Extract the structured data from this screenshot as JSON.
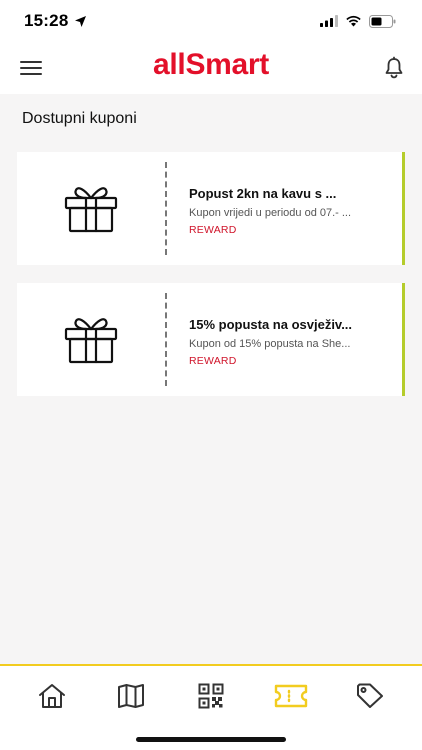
{
  "status_bar": {
    "time": "15:28"
  },
  "header": {
    "logo_text": "allSmart",
    "brand_color": "#e3102a"
  },
  "section": {
    "title": "Dostupni kuponi"
  },
  "coupons": [
    {
      "title": "Popust 2kn na kavu s ...",
      "description": "Kupon vrijedi u periodu od 07.- ...",
      "type": "REWARD",
      "icon": "gift-icon"
    },
    {
      "title": "15% popusta na osvježiv...",
      "description": "Kupon od 15% popusta na She...",
      "type": "REWARD",
      "icon": "gift-icon"
    }
  ],
  "tab_bar": {
    "active_color": "#f2cc1f",
    "tabs": [
      {
        "icon": "home-icon",
        "active": false
      },
      {
        "icon": "map-icon",
        "active": false
      },
      {
        "icon": "qr-code-icon",
        "active": false
      },
      {
        "icon": "ticket-icon",
        "active": true
      },
      {
        "icon": "tag-icon",
        "active": false
      }
    ]
  }
}
